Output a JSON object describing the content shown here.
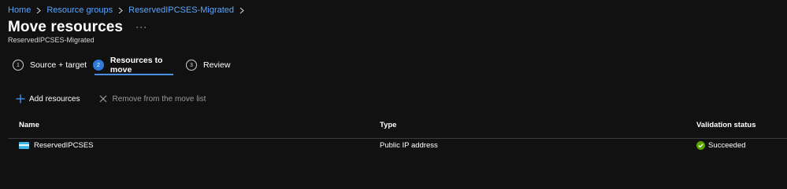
{
  "breadcrumb": {
    "items": [
      "Home",
      "Resource groups",
      "ReservedIPCSES-Migrated"
    ]
  },
  "header": {
    "title": "Move resources",
    "more": "···",
    "subtitle": "ReservedIPCSES-Migrated"
  },
  "stepper": {
    "steps": [
      {
        "number": "1",
        "label": "Source + target"
      },
      {
        "number": "2",
        "label": "Resources to move"
      },
      {
        "number": "3",
        "label": "Review"
      }
    ],
    "active_step": 2
  },
  "toolbar": {
    "add_label": "Add resources",
    "remove_label": "Remove from the move list"
  },
  "grid": {
    "columns": [
      "Name",
      "Type",
      "Validation status"
    ],
    "rows": [
      {
        "name": "ReservedIPCSES",
        "type": "Public IP address",
        "status": "Succeeded",
        "icon": "public-ip-icon",
        "status_icon": "success-check-icon"
      }
    ]
  },
  "colors": {
    "background": "#111111",
    "link": "#5aa6ff",
    "accent": "#2f7bd8",
    "success": "#57a300"
  }
}
